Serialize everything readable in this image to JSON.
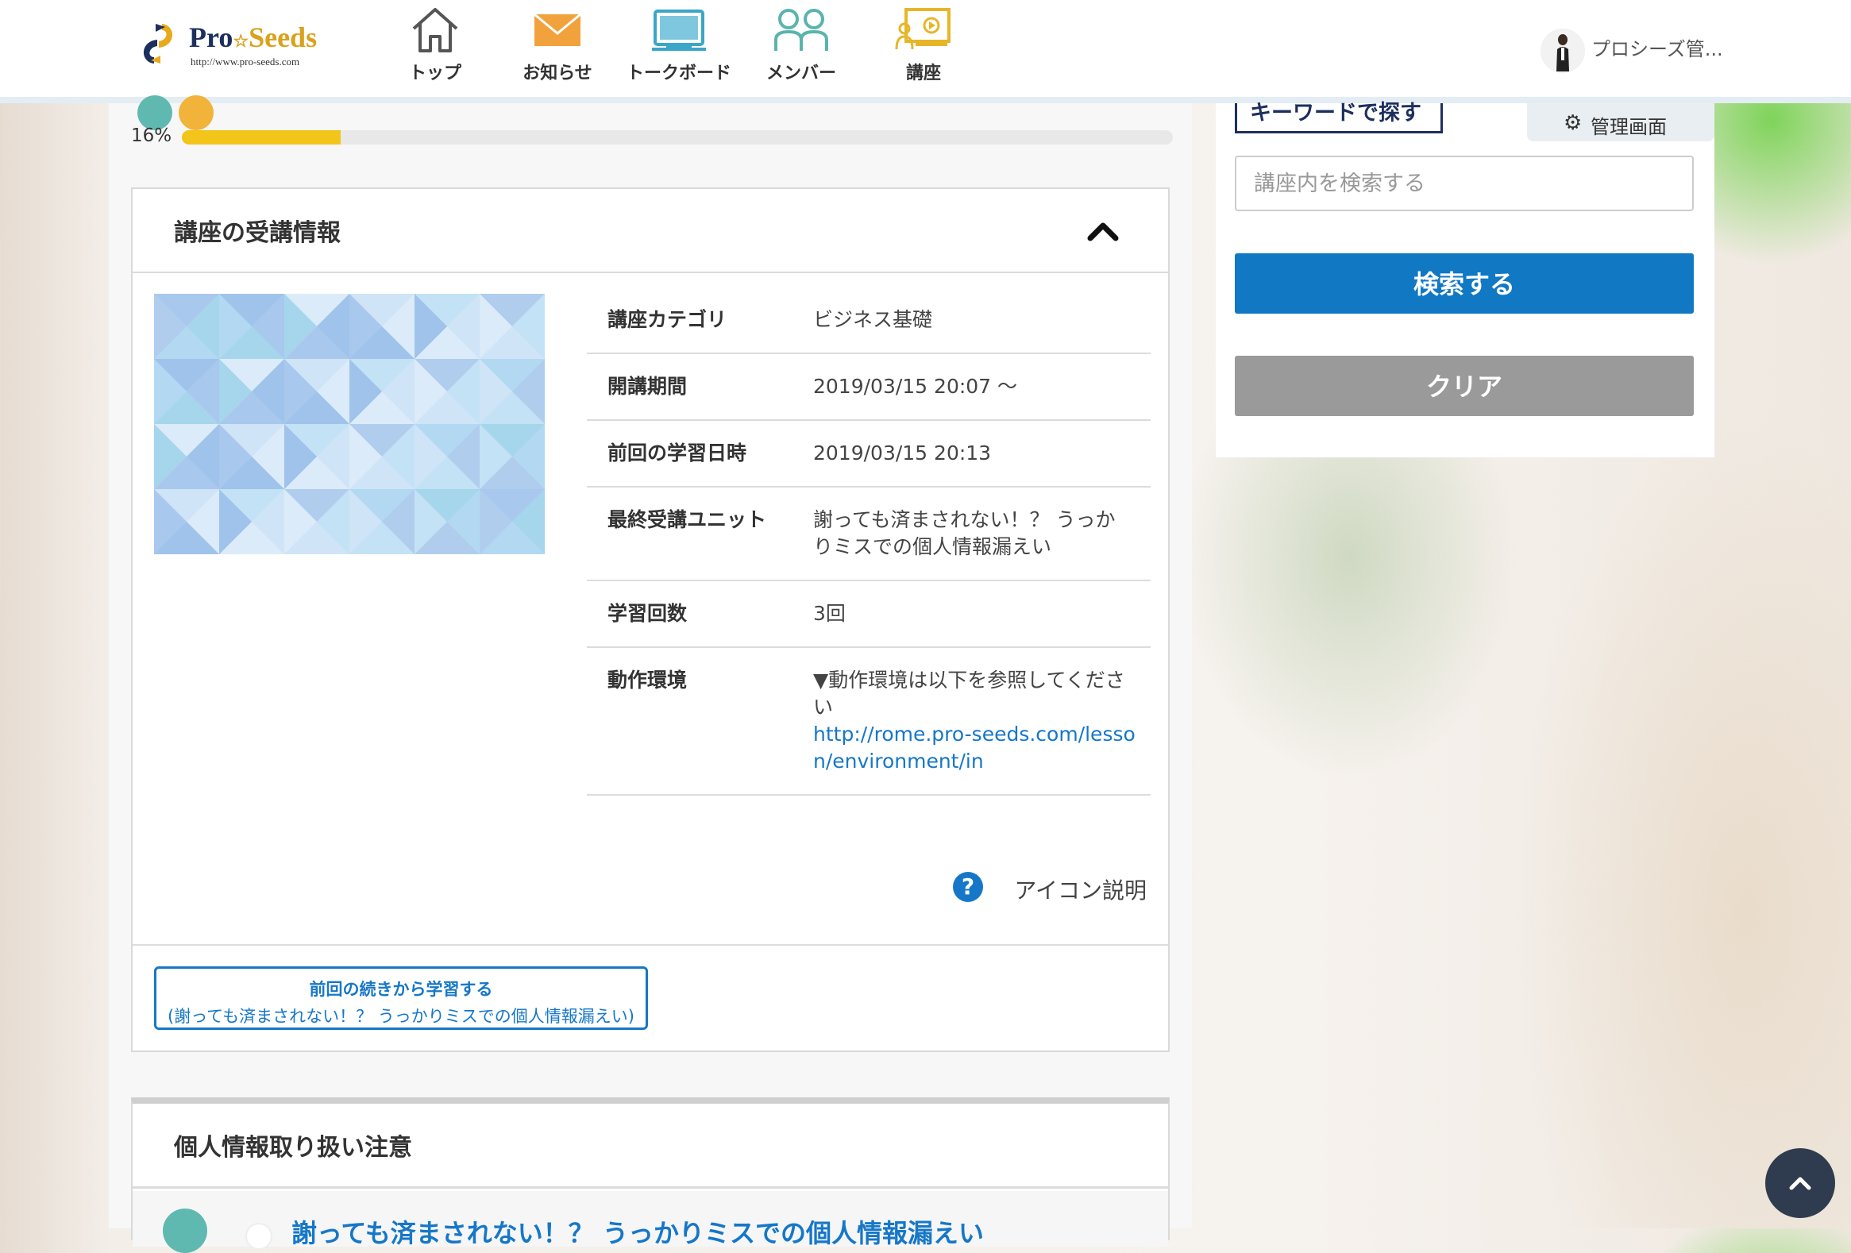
{
  "header": {
    "logo": {
      "brand_main": "Pro",
      "brand_star": "☆",
      "brand_second": "Seeds",
      "url": "http://www.pro-seeds.com"
    },
    "nav": [
      {
        "label": "トップ",
        "icon": "home-icon"
      },
      {
        "label": "お知らせ",
        "icon": "mail-icon"
      },
      {
        "label": "トークボード",
        "icon": "monitor-icon"
      },
      {
        "label": "メンバー",
        "icon": "members-icon"
      },
      {
        "label": "講座",
        "icon": "course-icon"
      }
    ],
    "user": {
      "name": "プロシーズ管..."
    }
  },
  "progress": {
    "label": "16%",
    "value": 0.16,
    "color": "#f3c419"
  },
  "course_info": {
    "title": "講座の受講情報",
    "rows": [
      {
        "key": "講座カテゴリ",
        "value": "ビジネス基礎"
      },
      {
        "key": "開講期間",
        "value": "2019/03/15 20:07 ～"
      },
      {
        "key": "前回の学習日時",
        "value": "2019/03/15 20:13"
      },
      {
        "key": "最終受講ユニット",
        "value": "謝っても済まされない！？ うっかりミスでの個人情報漏えい"
      },
      {
        "key": "学習回数",
        "value": "3回"
      },
      {
        "key": "動作環境",
        "value": "▼動作環境は以下を参照してください",
        "link": "http://rome.pro-seeds.com/lesson/environment/in"
      }
    ],
    "icon_help": "アイコン説明",
    "resume": {
      "line1": "前回の続きから学習する",
      "line2": "(謝っても済まされない！？ うっかりミスでの個人情報漏えい)"
    }
  },
  "section2": {
    "title": "個人情報取り扱い注意",
    "item_text": "謝っても済まされない！？ うっかりミスでの個人情報漏えい"
  },
  "sidebar": {
    "keyword_tab": "キーワードで探す",
    "admin_link": "管理画面",
    "search_placeholder": "講座内を検索する",
    "search_button": "検索する",
    "clear_button": "クリア"
  },
  "colors": {
    "accent_blue": "#1178c4",
    "progress_yellow": "#f3c419",
    "clear_gray": "#9a9a9a",
    "navy": "#1d2f5e"
  }
}
